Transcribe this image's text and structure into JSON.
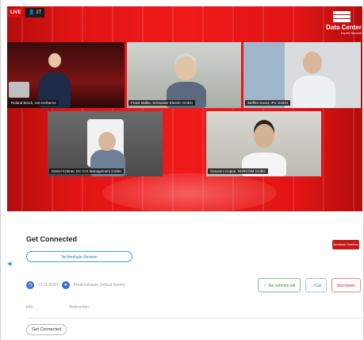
{
  "stream": {
    "live_label": "LIVE",
    "viewers": "27"
  },
  "logo": {
    "line1": "Data Center",
    "line2": "Expert Summit"
  },
  "participants": [
    {
      "name": "Roland Broch, von Kerberos"
    },
    {
      "name": "Frank Müller, Schneider Electric GmbH"
    },
    {
      "name": "Steffen Dovid, IPV GmbH"
    },
    {
      "name": "Daniel Krämer, DC-CIX Management GmbH"
    },
    {
      "name": "Giovanni Coppe, NORCOM GmbH"
    }
  ],
  "session": {
    "title": "Get Connected",
    "category_button": "Technologie-Session",
    "date": "17.11.2020",
    "location": "Breakoutraum (Virtual Room)",
    "side_badge": "Breakout Session"
  },
  "actions": {
    "attended": "Sie nehmen teil",
    "ical": "iCal",
    "cancel": "Stornieren"
  },
  "tabs": [
    "Info",
    "Referenten"
  ],
  "chip": "Get Connected",
  "colors": {
    "brand_red": "#e01414",
    "accent_blue": "#3aa0d6"
  }
}
